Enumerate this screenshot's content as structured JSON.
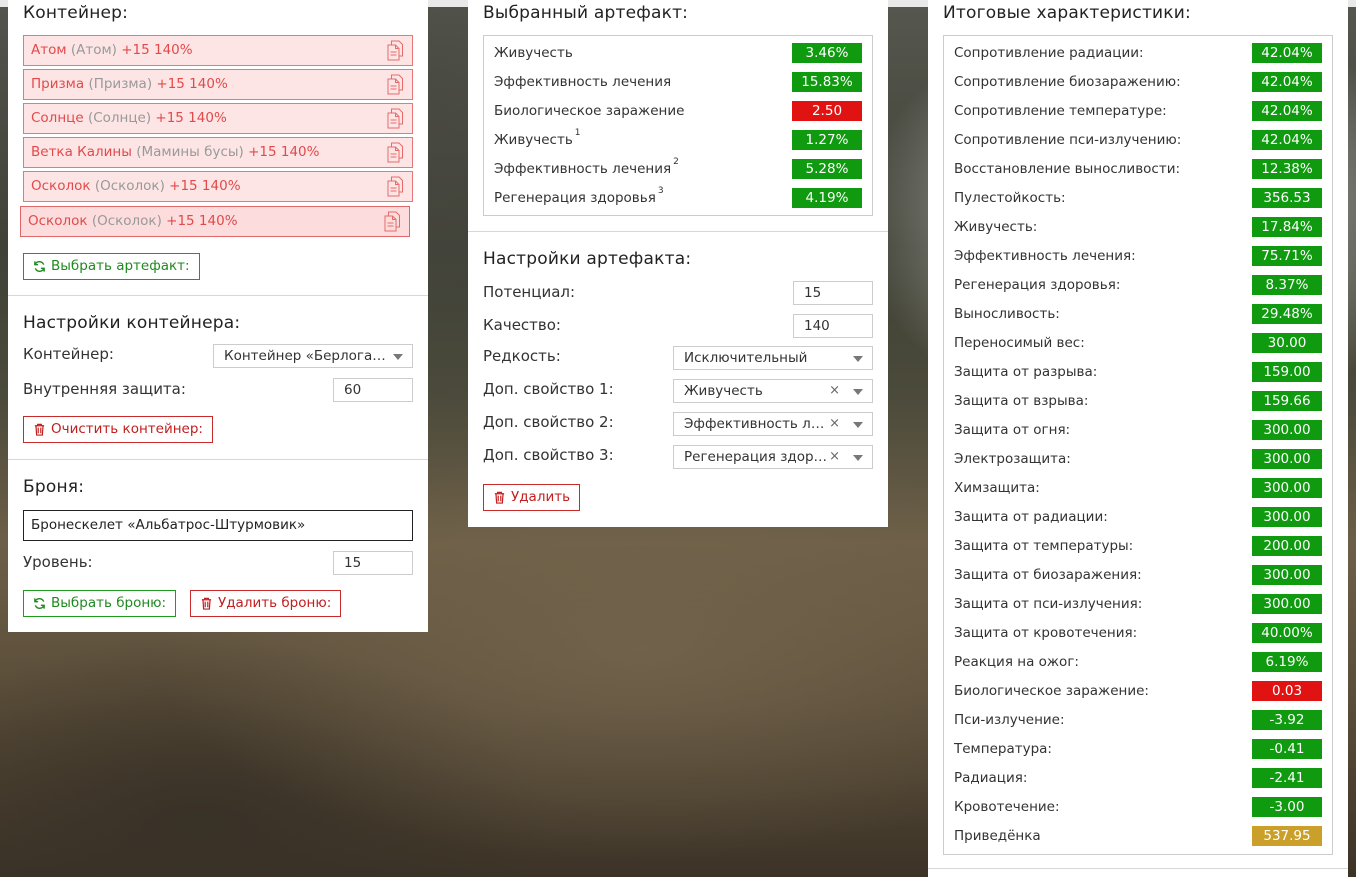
{
  "left": {
    "container_title": "Контейнер:",
    "items": [
      {
        "name": "Атом",
        "sub": "(Атом)",
        "bonus": "+15 140%"
      },
      {
        "name": "Призма",
        "sub": "(Призма)",
        "bonus": "+15 140%"
      },
      {
        "name": "Солнце",
        "sub": "(Солнце)",
        "bonus": "+15 140%"
      },
      {
        "name": "Ветка Калины",
        "sub": "(Мамины бусы)",
        "bonus": "+15 140%"
      },
      {
        "name": "Осколок",
        "sub": "(Осколок)",
        "bonus": "+15 140%"
      },
      {
        "name": "Осколок",
        "sub": "(Осколок)",
        "bonus": "+15 140%"
      }
    ],
    "select_artifact_btn": "Выбрать артефакт:",
    "container_settings_title": "Настройки контейнера:",
    "container_label": "Контейнер:",
    "container_value": "Контейнер «Берлога…",
    "inner_protection_label": "Внутренняя защита:",
    "inner_protection_value": "60",
    "clear_container_btn": "Очистить контейнер:",
    "armor_title": "Броня:",
    "armor_value": "Бронескелет «Альбатрос-Штурмовик»",
    "level_label": "Уровень:",
    "level_value": "15",
    "select_armor_btn": "Выбрать броню:",
    "delete_armor_btn": "Удалить броню:"
  },
  "middle": {
    "selected_title": "Выбранный артефакт:",
    "stats": [
      {
        "label": "Живучесть",
        "sup": "",
        "value": "3.46%",
        "color": "g"
      },
      {
        "label": "Эффективность лечения",
        "sup": "",
        "value": "15.83%",
        "color": "g"
      },
      {
        "label": "Биологическое заражение",
        "sup": "",
        "value": "2.50",
        "color": "r"
      },
      {
        "label": "Живучесть",
        "sup": "1",
        "value": "1.27%",
        "color": "g"
      },
      {
        "label": "Эффективность лечения",
        "sup": "2",
        "value": "5.28%",
        "color": "g"
      },
      {
        "label": "Регенерация здоровья",
        "sup": "3",
        "value": "4.19%",
        "color": "g"
      }
    ],
    "settings_title": "Настройки артефакта:",
    "potential_label": "Потенциал:",
    "potential_value": "15",
    "quality_label": "Качество:",
    "quality_value": "140",
    "rarity_label": "Редкость:",
    "rarity_value": "Исключительный",
    "extra1_label": "Доп. свойство 1:",
    "extra1_value": "Живучесть",
    "extra2_label": "Доп. свойство 2:",
    "extra2_value": "Эффективность ле…",
    "extra3_label": "Доп. свойство 3:",
    "extra3_value": "Регенерация здор…",
    "clear_symbol": "×",
    "delete_btn": "Удалить"
  },
  "right": {
    "title": "Итоговые характеристики:",
    "stats": [
      {
        "label": "Сопротивление радиации:",
        "value": "42.04%",
        "color": "g"
      },
      {
        "label": "Сопротивление биозаражению:",
        "value": "42.04%",
        "color": "g"
      },
      {
        "label": "Сопротивление температуре:",
        "value": "42.04%",
        "color": "g"
      },
      {
        "label": "Сопротивление пси-излучению:",
        "value": "42.04%",
        "color": "g"
      },
      {
        "label": "Восстановление выносливости:",
        "value": "12.38%",
        "color": "g"
      },
      {
        "label": "Пулестойкость:",
        "value": "356.53",
        "color": "g"
      },
      {
        "label": "Живучесть:",
        "value": "17.84%",
        "color": "g"
      },
      {
        "label": "Эффективность лечения:",
        "value": "75.71%",
        "color": "g"
      },
      {
        "label": "Регенерация здоровья:",
        "value": "8.37%",
        "color": "g"
      },
      {
        "label": "Выносливость:",
        "value": "29.48%",
        "color": "g"
      },
      {
        "label": "Переносимый вес:",
        "value": "30.00",
        "color": "g"
      },
      {
        "label": "Защита от разрыва:",
        "value": "159.00",
        "color": "g"
      },
      {
        "label": "Защита от взрыва:",
        "value": "159.66",
        "color": "g"
      },
      {
        "label": "Защита от огня:",
        "value": "300.00",
        "color": "g"
      },
      {
        "label": "Электрозащита:",
        "value": "300.00",
        "color": "g"
      },
      {
        "label": "Химзащита:",
        "value": "300.00",
        "color": "g"
      },
      {
        "label": "Защита от радиации:",
        "value": "300.00",
        "color": "g"
      },
      {
        "label": "Защита от температуры:",
        "value": "200.00",
        "color": "g"
      },
      {
        "label": "Защита от биозаражения:",
        "value": "300.00",
        "color": "g"
      },
      {
        "label": "Защита от пси-излучения:",
        "value": "300.00",
        "color": "g"
      },
      {
        "label": "Защита от кровотечения:",
        "value": "40.00%",
        "color": "g"
      },
      {
        "label": "Реакция на ожог:",
        "value": "6.19%",
        "color": "g"
      },
      {
        "label": "Биологическое заражение:",
        "value": "0.03",
        "color": "r"
      },
      {
        "label": "Пси-излучение:",
        "value": "-3.92",
        "color": "g"
      },
      {
        "label": "Температура:",
        "value": "-0.41",
        "color": "g"
      },
      {
        "label": "Радиация:",
        "value": "-2.41",
        "color": "g"
      },
      {
        "label": "Кровотечение:",
        "value": "-3.00",
        "color": "g"
      },
      {
        "label": "Приведёнка",
        "value": "537.95",
        "color": "y"
      }
    ]
  },
  "colors": {
    "green": "#0f9a0f",
    "red": "#e01212",
    "yellow": "#caa02a",
    "item_bg": "#fde5e5",
    "item_border": "#e87878"
  }
}
